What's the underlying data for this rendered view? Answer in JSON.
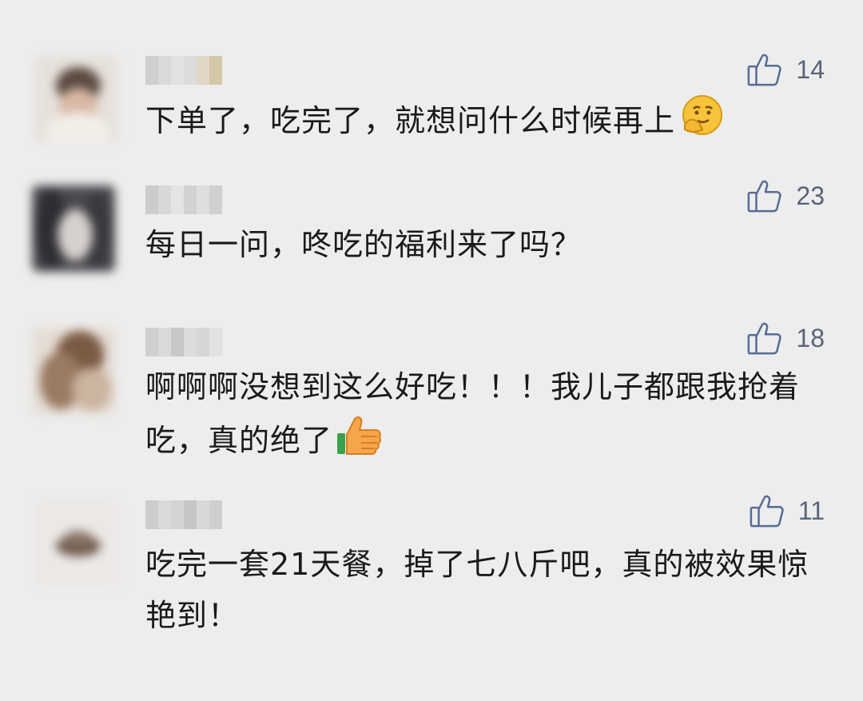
{
  "colors": {
    "background": "#ededed",
    "text": "#1a1a1a",
    "like_icon": "#576b95"
  },
  "comments": [
    {
      "like_count": "14",
      "text": "下单了，吃完了，就想问什么时候再上",
      "trailing_emoji": "smirk-face-emoji"
    },
    {
      "like_count": "23",
      "text": "每日一问，咚吃的福利来了吗？"
    },
    {
      "like_count": "18",
      "text": "啊啊啊没想到这么好吃！！！我儿子都跟我抢着吃，真的绝了",
      "trailing_emoji": "thumbs-up-emoji"
    },
    {
      "like_count": "11",
      "text": "吃完一套21天餐，掉了七八斤吧，真的被效果惊艳到！"
    }
  ]
}
